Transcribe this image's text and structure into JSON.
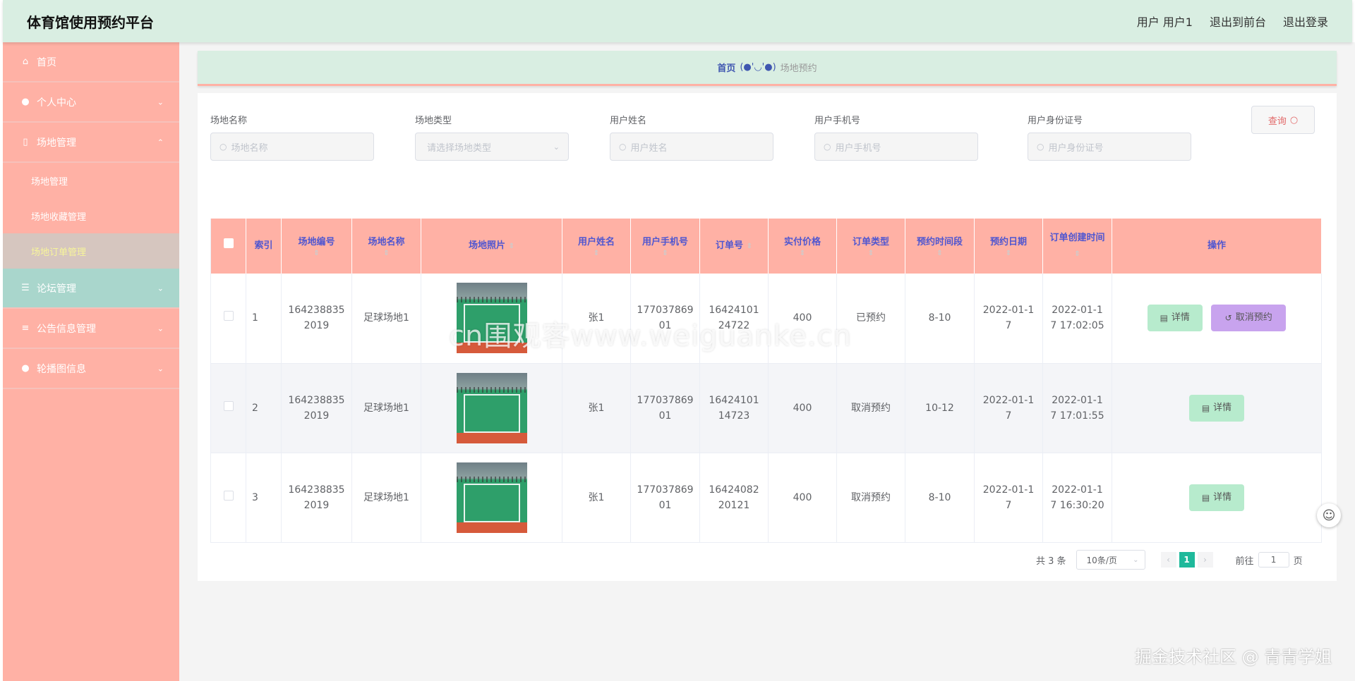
{
  "header": {
    "title": "体育馆使用预约平台",
    "user": "用户 用户1",
    "to_front": "退出到前台",
    "logout": "退出登录"
  },
  "sidebar": {
    "home": "首页",
    "personal": "个人中心",
    "venue_mgmt": "场地管理",
    "sub_venue": "场地管理",
    "sub_favorites": "场地收藏管理",
    "sub_orders": "场地订单管理",
    "forum": "论坛管理",
    "notice": "公告信息管理",
    "carousel": "轮播图信息"
  },
  "breadcrumb": {
    "home": "首页",
    "sep": "(●'◡'●)",
    "current": "场地预约"
  },
  "search": {
    "venue_name_label": "场地名称",
    "venue_name_placeholder": "场地名称",
    "venue_type_label": "场地类型",
    "venue_type_placeholder": "请选择场地类型",
    "user_name_label": "用户姓名",
    "user_name_placeholder": "用户姓名",
    "user_phone_label": "用户手机号",
    "user_phone_placeholder": "用户手机号",
    "user_id_label": "用户身份证号",
    "user_id_placeholder": "用户身份证号",
    "query_button": "查询"
  },
  "table": {
    "columns": {
      "index": "索引",
      "venue_no": "场地编号",
      "venue_name": "场地名称",
      "photo": "场地照片",
      "user_name": "用户姓名",
      "user_phone": "用户手机号",
      "order_no": "订单号",
      "price": "实付价格",
      "order_type": "订单类型",
      "slot": "预约时间段",
      "date": "预约日期",
      "created": "订单创建时间",
      "actions": "操作"
    },
    "rows": [
      {
        "index": "1",
        "venue_no": "1642388352019",
        "venue_name": "足球场地1",
        "user_name": "张1",
        "user_phone": "17703786901",
        "order_no": "1642410124722",
        "price": "400",
        "order_type": "已预约",
        "slot": "8-10",
        "date": "2022-01-17",
        "created": "2022-01-17 17:02:05"
      },
      {
        "index": "2",
        "venue_no": "1642388352019",
        "venue_name": "足球场地1",
        "user_name": "张1",
        "user_phone": "17703786901",
        "order_no": "1642410114723",
        "price": "400",
        "order_type": "取消预约",
        "slot": "10-12",
        "date": "2022-01-17",
        "created": "2022-01-17 17:01:55"
      },
      {
        "index": "3",
        "venue_no": "1642388352019",
        "venue_name": "足球场地1",
        "user_name": "张1",
        "user_phone": "17703786901",
        "order_no": "1642408220121",
        "price": "400",
        "order_type": "取消预约",
        "slot": "8-10",
        "date": "2022-01-17",
        "created": "2022-01-17 16:30:20"
      }
    ],
    "detail_button": "详情",
    "cancel_button": "取消预约"
  },
  "pagination": {
    "total": "共 3 条",
    "page_size": "10条/页",
    "current_page": "1",
    "goto_prefix": "前往",
    "goto_value": "1",
    "goto_suffix": "页"
  },
  "watermarks": {
    "center": "cn围观客www.weiguanke.cn",
    "bottom_right": "掘金技术社区 @ 青青学姐"
  },
  "colors": {
    "header_bg": "#d9eee2",
    "sidebar_bg": "#ffb1a5",
    "table_header_bg": "#ffb1a5",
    "detail_btn": "#b7ebcd",
    "cancel_btn": "#c8a3ee",
    "page_active": "#1fb99b"
  }
}
